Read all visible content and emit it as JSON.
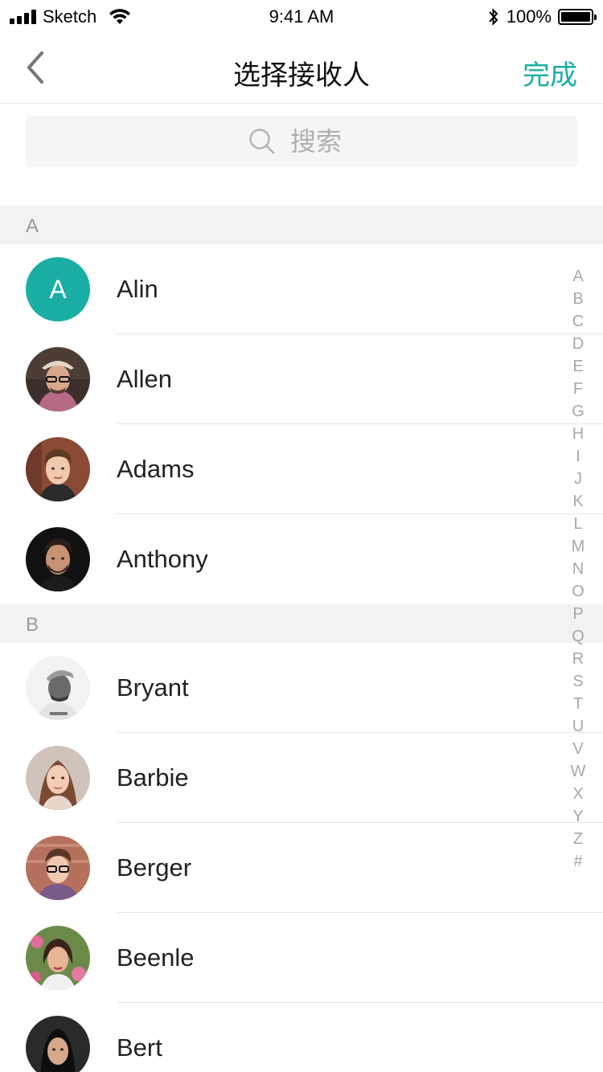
{
  "status_bar": {
    "carrier": "Sketch",
    "time": "9:41 AM",
    "battery": "100%"
  },
  "nav": {
    "title": "选择接收人",
    "done_label": "完成"
  },
  "search": {
    "placeholder": "搜索"
  },
  "sections": [
    {
      "letter": "A",
      "contacts": [
        {
          "name": "Alin",
          "avatar_letter": "A"
        },
        {
          "name": "Allen"
        },
        {
          "name": "Adams"
        },
        {
          "name": "Anthony"
        }
      ]
    },
    {
      "letter": "B",
      "contacts": [
        {
          "name": "Bryant"
        },
        {
          "name": "Barbie"
        },
        {
          "name": "Berger"
        },
        {
          "name": "Beenle"
        },
        {
          "name": "Bert"
        }
      ]
    }
  ],
  "index_letters": [
    "A",
    "B",
    "C",
    "D",
    "E",
    "F",
    "G",
    "H",
    "I",
    "J",
    "K",
    "L",
    "M",
    "N",
    "O",
    "P",
    "Q",
    "R",
    "S",
    "T",
    "U",
    "V",
    "W",
    "X",
    "Y",
    "Z",
    "#"
  ],
  "colors": {
    "accent": "#1aaea4",
    "section_bg": "#f2f2f2",
    "index_text": "#a8a8a8"
  }
}
